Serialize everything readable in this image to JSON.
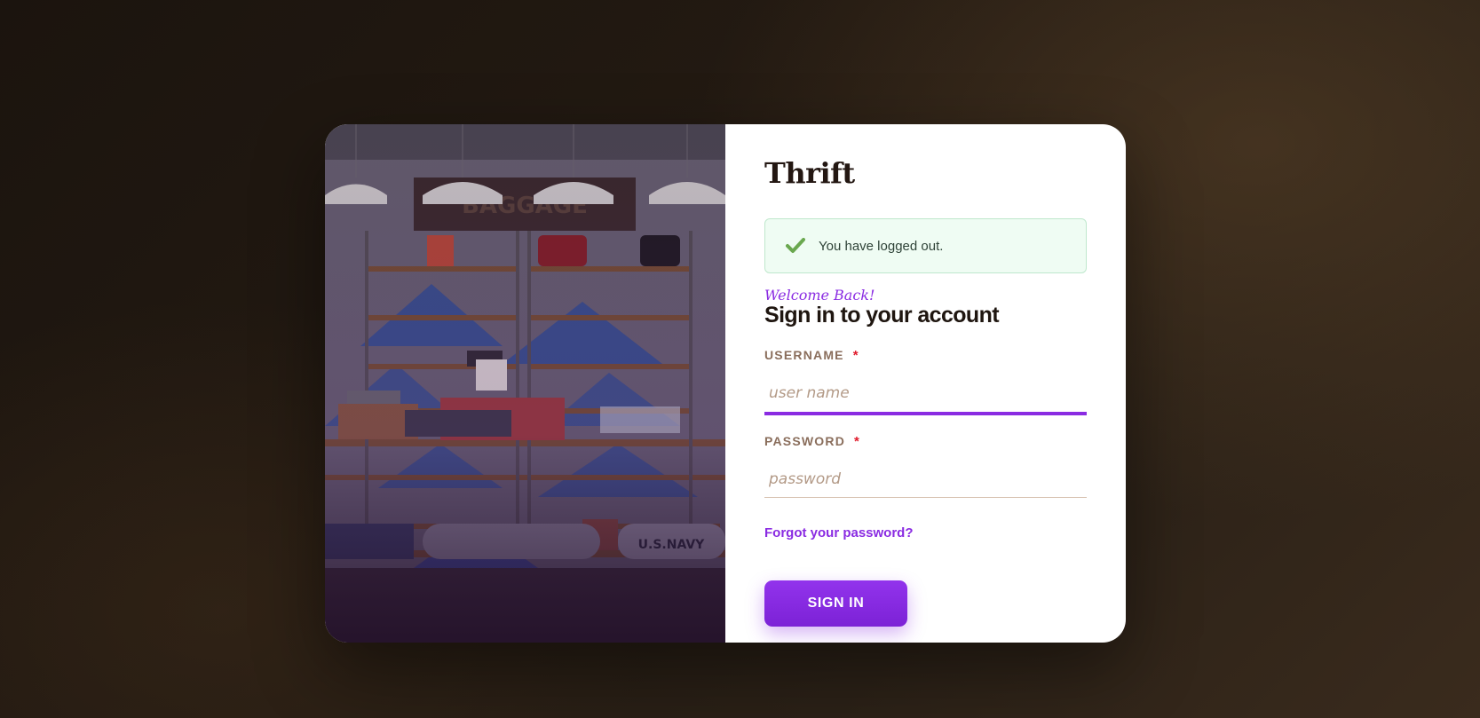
{
  "brand": {
    "name": "Thrift"
  },
  "alert": {
    "message": "You have logged out.",
    "icon": "check-icon",
    "color": "#6aa84f"
  },
  "form": {
    "welcome": "Welcome Back!",
    "heading": "Sign in to your account",
    "username": {
      "label": "USERNAME",
      "required_mark": "*",
      "placeholder": "user name",
      "value": ""
    },
    "password": {
      "label": "PASSWORD",
      "required_mark": "*",
      "placeholder": "password",
      "value": ""
    },
    "forgot_link": "Forgot your password?",
    "submit_label": "SIGN IN"
  },
  "colors": {
    "accent": "#8a2be2",
    "required": "#e01b2c",
    "label": "#8a6e5c"
  }
}
